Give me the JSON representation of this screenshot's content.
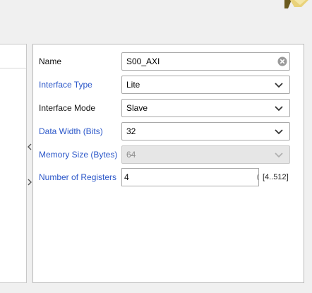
{
  "form": {
    "name_label": "Name",
    "name_value": "S00_AXI",
    "interface_type_label": "Interface Type",
    "interface_type_value": "Lite",
    "interface_mode_label": "Interface Mode",
    "interface_mode_value": "Slave",
    "data_width_label": "Data Width (Bits)",
    "data_width_value": "32",
    "memory_size_label": "Memory Size (Bytes)",
    "memory_size_value": "64",
    "num_registers_label": "Number of Registers",
    "num_registers_value": "4",
    "num_registers_range": "[4..512]"
  },
  "icons": {
    "clear": "clear-circle-icon",
    "dropdown": "chevron-down-icon",
    "collapse_left": "chevron-left-icon",
    "expand_right": "chevron-right-icon",
    "logo": "logo-icon"
  },
  "colors": {
    "param_label_blue": "#2b57c9",
    "logo_gold": "#c8a23a"
  }
}
